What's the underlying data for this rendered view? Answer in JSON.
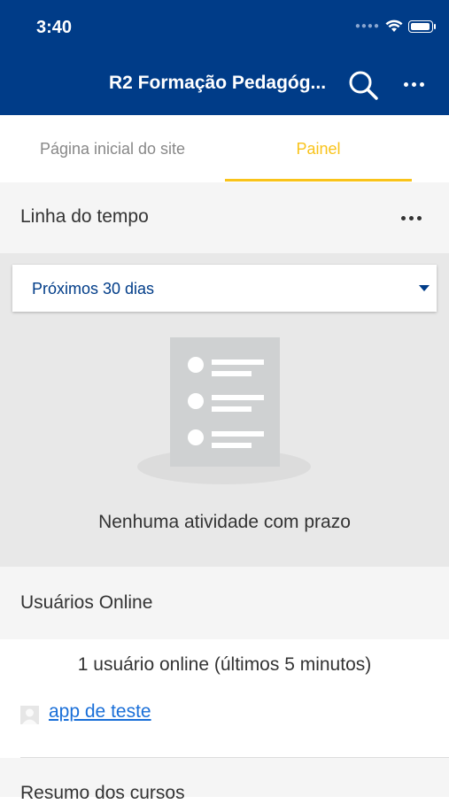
{
  "status_bar": {
    "time": "3:40"
  },
  "header": {
    "title": "R2 Formação Pedagóg..."
  },
  "tabs": [
    {
      "label": "Página inicial do site",
      "active": false
    },
    {
      "label": "Painel",
      "active": true
    }
  ],
  "timeline": {
    "title": "Linha do tempo",
    "filter_value": "Próximos 30 dias",
    "empty_message": "Nenhuma atividade com prazo"
  },
  "online_users": {
    "title": "Usuários Online",
    "count_text": "1 usuário online (últimos 5 minutos)",
    "users": [
      {
        "name": "app de teste"
      }
    ]
  },
  "course_summary": {
    "title": "Resumo dos cursos"
  },
  "colors": {
    "header_bg": "#003c88",
    "accent": "#f9c31a",
    "link": "#1a6fd8"
  }
}
